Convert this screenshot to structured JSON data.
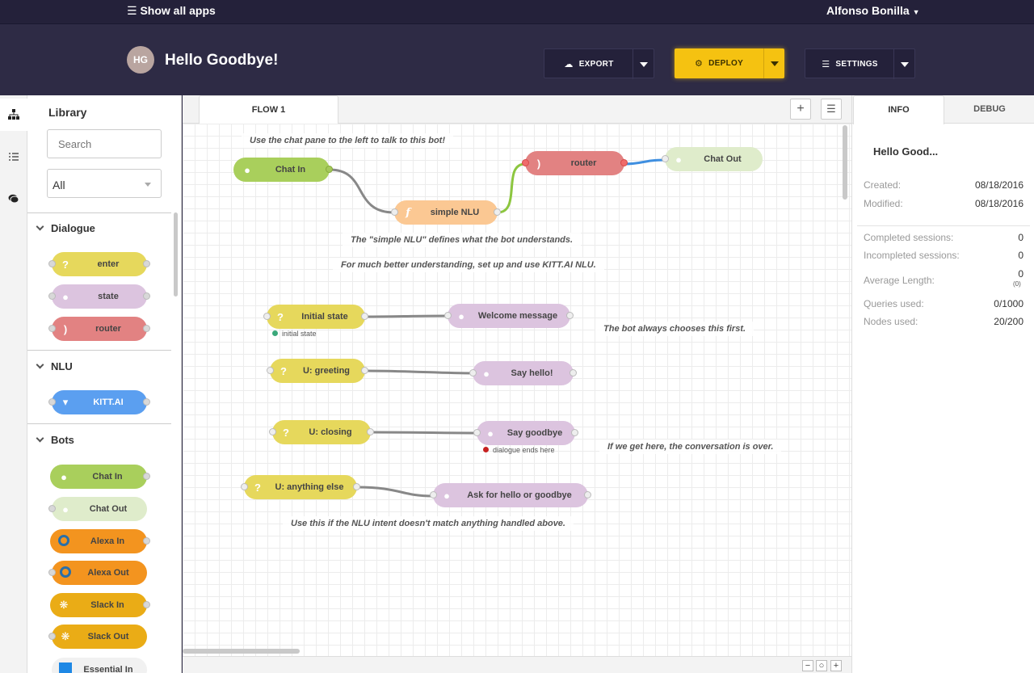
{
  "topbar": {
    "apps_label": "Show all apps",
    "user_name": "Alfonso Bonilla"
  },
  "header": {
    "avatar_initials": "HG",
    "app_title": "Hello Goodbye!",
    "export_label": "EXPORT",
    "deploy_label": "DEPLOY",
    "settings_label": "SETTINGS"
  },
  "library": {
    "title": "Library",
    "search_placeholder": "Search",
    "filter_value": "All",
    "categories": {
      "dialogue": "Dialogue",
      "nlu": "NLU",
      "bots": "Bots"
    },
    "nodes": {
      "enter": "enter",
      "state": "state",
      "router": "router",
      "kitt": "KITT.AI",
      "chat_in": "Chat In",
      "chat_out": "Chat Out",
      "alexa_in": "Alexa In",
      "alexa_out": "Alexa Out",
      "slack_in": "Slack In",
      "slack_out": "Slack Out",
      "essential_in": "Essential In"
    }
  },
  "workspace": {
    "tab_label": "FLOW 1",
    "comments": {
      "c1": "Use the chat pane to the left to talk to this bot!",
      "c2": "The \"simple NLU\" defines what the bot understands.",
      "c3": "For much better understanding, set up and use KITT.AI NLU.",
      "c4": "The bot always chooses this first.",
      "c5": "If we get here, the conversation is over.",
      "c6": "Use this if the NLU intent doesn't match anything handled above."
    },
    "nodes": {
      "chat_in": "Chat In",
      "simple_nlu": "simple NLU",
      "router": "router",
      "chat_out": "Chat Out",
      "initial_state": "Initial state",
      "welcome": "Welcome message",
      "greeting": "U: greeting",
      "say_hello": "Say hello!",
      "closing": "U: closing",
      "say_goodbye": "Say goodbye",
      "anything_else": "U: anything else",
      "ask": "Ask for hello or goodbye"
    },
    "status": {
      "initial": "initial state",
      "ends": "dialogue ends here"
    }
  },
  "info": {
    "tab_info": "INFO",
    "tab_debug": "DEBUG",
    "title": "Hello Good...",
    "created_label": "Created:",
    "created_value": "08/18/2016",
    "modified_label": "Modified:",
    "modified_value": "08/18/2016",
    "completed_label": "Completed sessions:",
    "completed_value": "0",
    "incompleted_label": "Incompleted sessions:",
    "incompleted_value": "0",
    "avg_label": "Average Length:",
    "avg_value": "0",
    "avg_sub": "(0)",
    "queries_label": "Queries used:",
    "queries_value": "0/1000",
    "nodes_label": "Nodes used:",
    "nodes_value": "20/200"
  },
  "colors": {
    "deploy": "#f5c211",
    "header_bg": "#2e2b45",
    "topbar_bg": "#24213a"
  }
}
